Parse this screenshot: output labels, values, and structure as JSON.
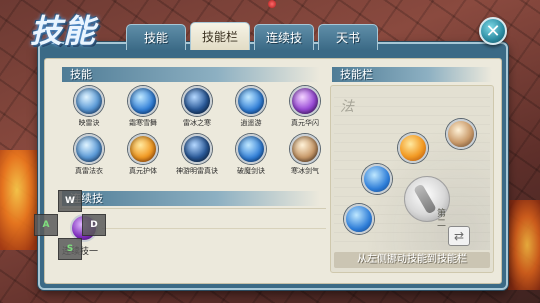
{
  "title": "技能",
  "tabs": [
    {
      "label": "技能",
      "active": false
    },
    {
      "label": "技能栏",
      "active": true
    },
    {
      "label": "连续技",
      "active": false
    },
    {
      "label": "天书",
      "active": false
    }
  ],
  "close": {
    "icon": "close-icon",
    "glyph": "✕"
  },
  "skills_section": {
    "header": "技能",
    "items": [
      {
        "label": "映雷诀",
        "icon": "lightning-orb-icon",
        "style": "storm"
      },
      {
        "label": "霜寒雪舞",
        "icon": "frost-swirl-icon",
        "style": "ice"
      },
      {
        "label": "雷冰之寒",
        "icon": "ice-lightning-icon",
        "style": "dark"
      },
      {
        "label": "逍遥游",
        "icon": "wind-dash-icon",
        "style": "ice"
      },
      {
        "label": "真元华闪",
        "icon": "violet-flash-icon",
        "style": "violet"
      },
      {
        "label": "真雷法衣",
        "icon": "thunder-robe-icon",
        "style": "storm"
      },
      {
        "label": "真元护体",
        "icon": "fire-shield-icon",
        "style": "fire"
      },
      {
        "label": "神游明雷真诀",
        "icon": "spirit-thunder-icon",
        "style": "dark"
      },
      {
        "label": "破魔剑诀",
        "icon": "sword-wave-icon",
        "style": "ice"
      },
      {
        "label": "寒冰剑气",
        "icon": "ghost-warrior-icon",
        "style": "ghost"
      }
    ]
  },
  "combo_section": {
    "header": "连续技",
    "slot_label": "连续技一"
  },
  "dpad": {
    "up": "W",
    "left": "A",
    "right": "D",
    "down": "S"
  },
  "bar_section": {
    "header": "技能栏",
    "calligraphy": "法",
    "page_label": "第二",
    "switch_glyph": "⇄",
    "hint": "从左侧挪动技能到技能栏"
  },
  "colors": {
    "panel_frame": "#3b6a86",
    "panel_bg": "#ece9dc",
    "tab_active": "#f6f3e6",
    "section_header": "#4f7c96"
  }
}
